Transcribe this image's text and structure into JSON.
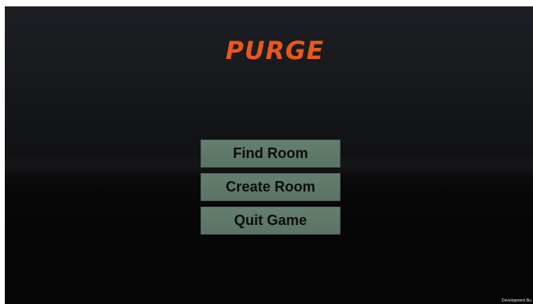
{
  "game": {
    "title": "PURGE",
    "title_color": "#e8581c",
    "button_color": "#5b7566"
  },
  "menu": {
    "find_room_label": "Find Room",
    "create_room_label": "Create Room",
    "quit_game_label": "Quit Game"
  },
  "footer": {
    "dev_build_label": "Development Bu"
  }
}
